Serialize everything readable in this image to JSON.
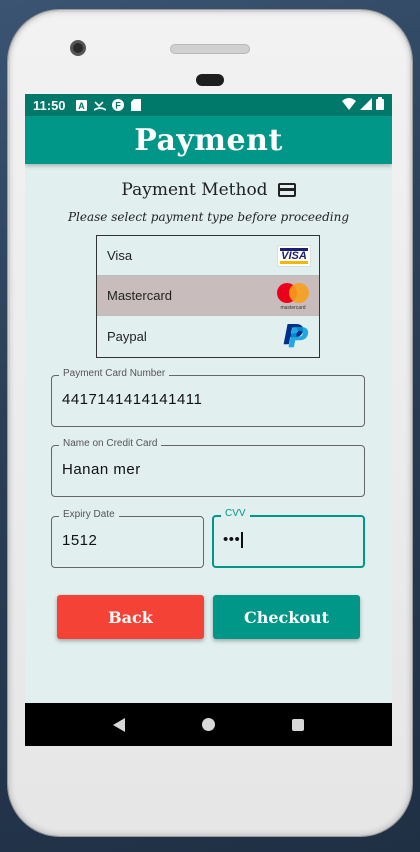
{
  "status_bar": {
    "time": "11:50"
  },
  "app_bar": {
    "title": "Payment"
  },
  "payment_method": {
    "title": "Payment Method",
    "subtitle": "Please select payment type before proceeding",
    "options": [
      {
        "label": "Visa",
        "logo_text": "VISA",
        "selected": false
      },
      {
        "label": "Mastercard",
        "logo_text": "mastercard",
        "selected": true
      },
      {
        "label": "Paypal",
        "logo_text": "P",
        "selected": false
      }
    ]
  },
  "form": {
    "card_number": {
      "label": "Payment Card Number",
      "value": "4417141414141411"
    },
    "name_on_card": {
      "label": "Name on Credit Card",
      "value": "Hanan mer"
    },
    "expiry": {
      "label": "Expiry Date",
      "value": "1512"
    },
    "cvv": {
      "label": "CVV",
      "value": "•••"
    }
  },
  "buttons": {
    "back": "Back",
    "checkout": "Checkout"
  },
  "colors": {
    "primary": "#009688",
    "primary_dark": "#00796b",
    "back_button": "#f44336",
    "background": "#e1efee",
    "selected_row": "#c8bcbc"
  }
}
